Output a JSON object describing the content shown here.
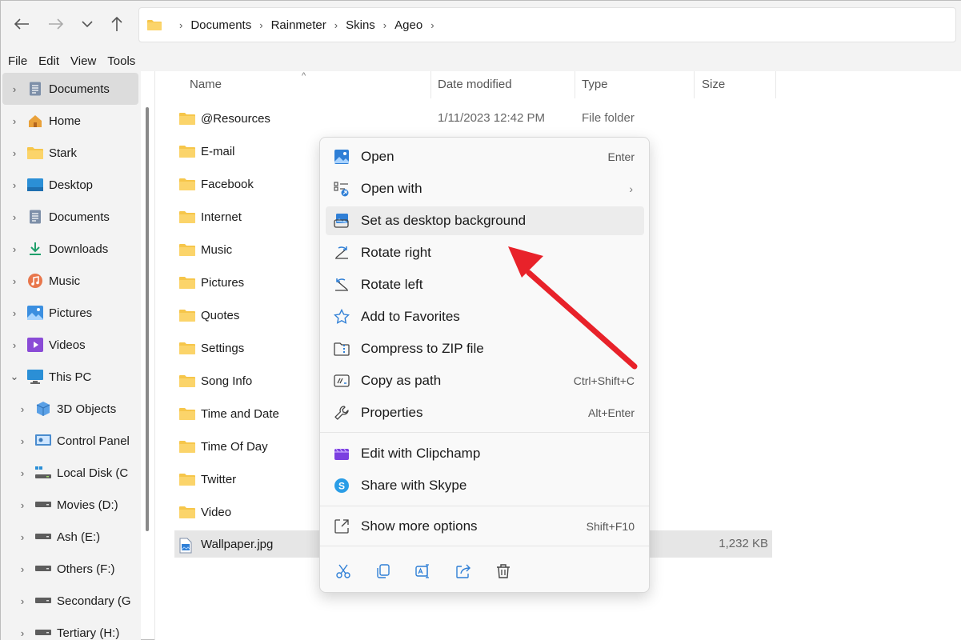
{
  "address": {
    "crumbs": [
      "Documents",
      "Rainmeter",
      "Skins",
      "Ageo"
    ]
  },
  "menu": [
    "File",
    "Edit",
    "View",
    "Tools"
  ],
  "sidebar": {
    "items": [
      {
        "label": "Documents",
        "icon": "documents-icon"
      },
      {
        "label": "Home",
        "icon": "home-icon"
      },
      {
        "label": "Stark",
        "icon": "folder-icon"
      },
      {
        "label": "Desktop",
        "icon": "desktop-icon"
      },
      {
        "label": "Documents",
        "icon": "documents-icon"
      },
      {
        "label": "Downloads",
        "icon": "download-icon"
      },
      {
        "label": "Music",
        "icon": "music-icon"
      },
      {
        "label": "Pictures",
        "icon": "pictures-icon"
      },
      {
        "label": "Videos",
        "icon": "videos-icon"
      },
      {
        "label": "This PC",
        "icon": "computer-icon"
      },
      {
        "label": "3D Objects",
        "icon": "cube-icon"
      },
      {
        "label": "Control Panel",
        "icon": "control-panel-icon"
      },
      {
        "label": "Local Disk (C",
        "icon": "disk-icon"
      },
      {
        "label": "Movies (D:)",
        "icon": "drive-icon"
      },
      {
        "label": "Ash (E:)",
        "icon": "drive-icon"
      },
      {
        "label": "Others (F:)",
        "icon": "drive-icon"
      },
      {
        "label": "Secondary (G",
        "icon": "drive-icon"
      },
      {
        "label": "Tertiary (H:)",
        "icon": "drive-icon"
      }
    ]
  },
  "columns": {
    "name": "Name",
    "date": "Date modified",
    "type": "Type",
    "size": "Size"
  },
  "files": [
    {
      "name": "@Resources",
      "date": "1/11/2023 12:42 PM",
      "type": "File folder",
      "size": ""
    },
    {
      "name": "E-mail",
      "date": "",
      "type": "",
      "size": ""
    },
    {
      "name": "Facebook",
      "date": "",
      "type": "",
      "size": ""
    },
    {
      "name": "Internet",
      "date": "",
      "type": "",
      "size": ""
    },
    {
      "name": "Music",
      "date": "",
      "type": "",
      "size": ""
    },
    {
      "name": "Pictures",
      "date": "",
      "type": "",
      "size": ""
    },
    {
      "name": "Quotes",
      "date": "",
      "type": "",
      "size": ""
    },
    {
      "name": "Settings",
      "date": "",
      "type": "",
      "size": ""
    },
    {
      "name": "Song Info",
      "date": "",
      "type": "",
      "size": ""
    },
    {
      "name": "Time and Date",
      "date": "",
      "type": "",
      "size": ""
    },
    {
      "name": "Time Of Day",
      "date": "",
      "type": "",
      "size": ""
    },
    {
      "name": "Twitter",
      "date": "",
      "type": "",
      "size": ""
    },
    {
      "name": "Video",
      "date": "",
      "type": "",
      "size": ""
    },
    {
      "name": "Wallpaper.jpg",
      "date": "",
      "type": "",
      "size": "1,232 KB"
    }
  ],
  "context_menu": {
    "items": [
      {
        "label": "Open",
        "shortcut": "Enter",
        "icon": "open-image-icon"
      },
      {
        "label": "Open with",
        "shortcut": "",
        "icon": "open-with-icon",
        "submenu": "›"
      },
      {
        "label": "Set as desktop background",
        "shortcut": "",
        "icon": "desktop-background-icon"
      },
      {
        "label": "Rotate right",
        "shortcut": "",
        "icon": "rotate-right-icon"
      },
      {
        "label": "Rotate left",
        "shortcut": "",
        "icon": "rotate-left-icon"
      },
      {
        "label": "Add to Favorites",
        "shortcut": "",
        "icon": "star-icon"
      },
      {
        "label": "Compress to ZIP file",
        "shortcut": "",
        "icon": "zip-icon"
      },
      {
        "label": "Copy as path",
        "shortcut": "Ctrl+Shift+C",
        "icon": "copy-path-icon"
      },
      {
        "label": "Properties",
        "shortcut": "Alt+Enter",
        "icon": "wrench-icon"
      },
      {
        "label": "Edit with Clipchamp",
        "shortcut": "",
        "icon": "clipchamp-icon"
      },
      {
        "label": "Share with Skype",
        "shortcut": "",
        "icon": "skype-icon"
      },
      {
        "label": "Show more options",
        "shortcut": "Shift+F10",
        "icon": "more-options-icon"
      }
    ],
    "actions": [
      "cut-icon",
      "copy-icon",
      "rename-icon",
      "share-icon",
      "delete-icon"
    ]
  },
  "colors": {
    "accent": "#0067c0",
    "annotation_arrow": "#e8222a",
    "folder": "#f6c64a"
  }
}
